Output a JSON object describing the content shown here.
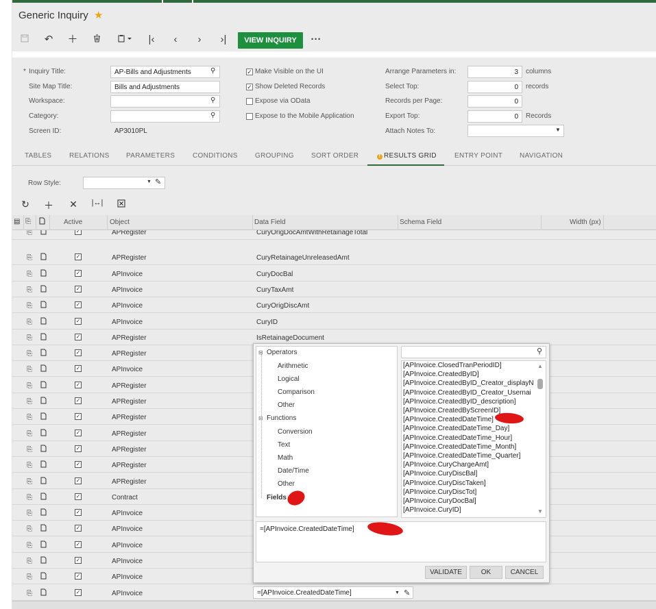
{
  "header": {
    "title": "Generic Inquiry",
    "view_inquiry_label": "VIEW INQUIRY"
  },
  "form": {
    "inquiry_title_label": "Inquiry Title:",
    "inquiry_title_value": "AP-Bills and Adjustments",
    "sitemap_title_label": "Site Map Title:",
    "sitemap_title_value": "Bills and Adjustments",
    "workspace_label": "Workspace:",
    "category_label": "Category:",
    "screen_id_label": "Screen ID:",
    "screen_id_value": "AP3010PL",
    "make_visible_label": "Make Visible on the UI",
    "show_deleted_label": "Show Deleted Records",
    "expose_odata_label": "Expose via OData",
    "expose_mobile_label": "Expose to the Mobile Application",
    "arrange_label": "Arrange Parameters in:",
    "arrange_value": "3",
    "arrange_unit": "columns",
    "select_top_label": "Select Top:",
    "select_top_value": "0",
    "select_top_unit": "records",
    "records_per_page_label": "Records per Page:",
    "records_per_page_value": "0",
    "export_top_label": "Export Top:",
    "export_top_value": "0",
    "export_top_unit": "Records",
    "attach_notes_label": "Attach Notes To:"
  },
  "tabs": [
    "TABLES",
    "RELATIONS",
    "PARAMETERS",
    "CONDITIONS",
    "GROUPING",
    "SORT ORDER",
    "RESULTS GRID",
    "ENTRY POINT",
    "NAVIGATION"
  ],
  "grid": {
    "row_style_label": "Row Style:",
    "headers": {
      "active": "Active",
      "object": "Object",
      "data_field": "Data Field",
      "schema_field": "Schema Field",
      "width": "Width (px)"
    },
    "rows": [
      {
        "object": "APRegister",
        "field": "CuryOrigDocAmtWithRetainageTotal"
      },
      {
        "object": "APRegister",
        "field": "CuryRetainageUnreleasedAmt"
      },
      {
        "object": "APInvoice",
        "field": "CuryDocBal"
      },
      {
        "object": "APInvoice",
        "field": "CuryTaxAmt"
      },
      {
        "object": "APInvoice",
        "field": "CuryOrigDiscAmt"
      },
      {
        "object": "APInvoice",
        "field": "CuryID"
      },
      {
        "object": "APRegister",
        "field": "IsRetainageDocument"
      },
      {
        "object": "APRegister",
        "field": ""
      },
      {
        "object": "APInvoice",
        "field": ""
      },
      {
        "object": "APRegister",
        "field": ""
      },
      {
        "object": "APRegister",
        "field": ""
      },
      {
        "object": "APRegister",
        "field": ""
      },
      {
        "object": "APRegister",
        "field": ""
      },
      {
        "object": "APRegister",
        "field": ""
      },
      {
        "object": "APRegister",
        "field": ""
      },
      {
        "object": "APRegister",
        "field": ""
      },
      {
        "object": "Contract",
        "field": ""
      },
      {
        "object": "APInvoice",
        "field": ""
      },
      {
        "object": "APInvoice",
        "field": ""
      },
      {
        "object": "APInvoice",
        "field": ""
      },
      {
        "object": "APInvoice",
        "field": ""
      },
      {
        "object": "APInvoice",
        "field": ""
      },
      {
        "object": "APInvoice",
        "field": "=[APInvoice.CreatedDateTime]"
      }
    ]
  },
  "formula_editor": {
    "tree": {
      "operators": "Operators",
      "arithmetic": "Arithmetic",
      "logical": "Logical",
      "comparison": "Comparison",
      "other1": "Other",
      "functions": "Functions",
      "conversion": "Conversion",
      "text": "Text",
      "math": "Math",
      "datetime": "Date/Time",
      "other2": "Other",
      "fields": "Fields"
    },
    "fields": [
      "[APInvoice.ClosedTranPeriodID]",
      "[APInvoice.CreatedByID]",
      "[APInvoice.CreatedByID_Creator_displayN",
      "[APInvoice.CreatedByID_Creator_Usernai",
      "[APInvoice.CreatedByID_description]",
      "[APInvoice.CreatedByScreenID]",
      "[APInvoice.CreatedDateTime]",
      "[APInvoice.CreatedDateTime_Day]",
      "[APInvoice.CreatedDateTime_Hour]",
      "[APInvoice.CreatedDateTime_Month]",
      "[APInvoice.CreatedDateTime_Quarter]",
      "[APInvoice.CuryChargeAmt]",
      "[APInvoice.CuryDiscBal]",
      "[APInvoice.CuryDiscTaken]",
      "[APInvoice.CuryDiscTot]",
      "[APInvoice.CuryDocBal]",
      "[APInvoice.CuryID]"
    ],
    "expression": "=[APInvoice.CreatedDateTime]",
    "validate_label": "VALIDATE",
    "ok_label": "OK",
    "cancel_label": "CANCEL"
  }
}
